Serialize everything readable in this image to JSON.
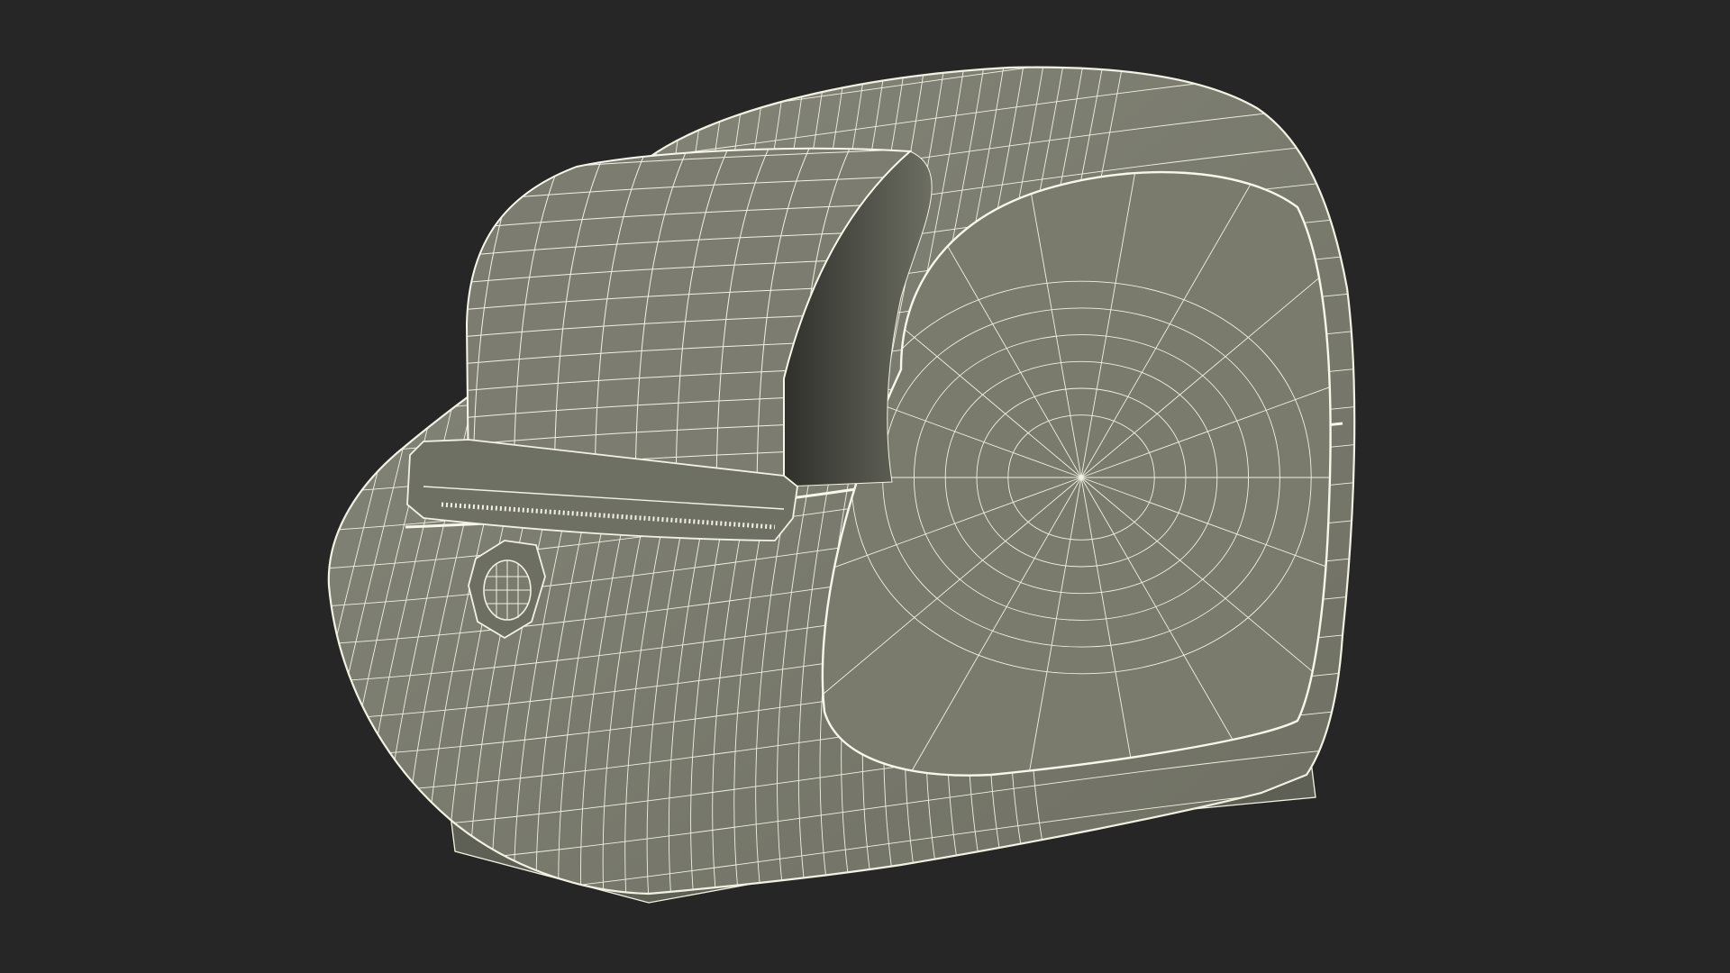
{
  "scene": {
    "subject": "wireframe-3d-model-label-printer",
    "background_color": "#262626",
    "body_color": "#7a7b6d",
    "shadow_color": "#3e3f38",
    "wire_color": "#f2f2e2",
    "render_style": "wireframe-over-flat-shading"
  },
  "parts": [
    {
      "id": "printer-body"
    },
    {
      "id": "label-paper-strip"
    },
    {
      "id": "paper-exit-slot"
    },
    {
      "id": "front-button"
    },
    {
      "id": "side-panel"
    },
    {
      "id": "base-plinth"
    }
  ]
}
